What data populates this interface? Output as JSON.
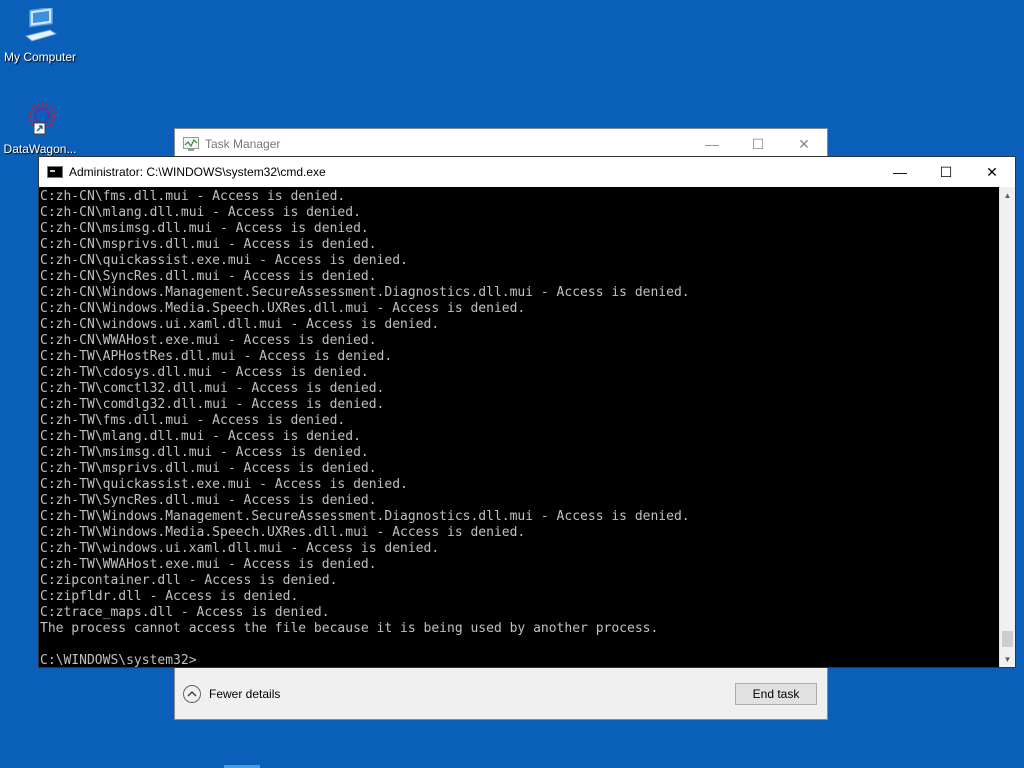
{
  "desktop": {
    "icons": [
      {
        "label": "My Computer",
        "icon": "computer-icon"
      },
      {
        "label": "DataWagon...",
        "icon": "datawagon-icon"
      }
    ]
  },
  "taskmgr": {
    "title": "Task Manager",
    "fewer_details": "Fewer details",
    "end_task": "End task"
  },
  "cmd": {
    "title": "Administrator: C:\\WINDOWS\\system32\\cmd.exe",
    "lines": [
      "C:zh-CN\\fms.dll.mui - Access is denied.",
      "C:zh-CN\\mlang.dll.mui - Access is denied.",
      "C:zh-CN\\msimsg.dll.mui - Access is denied.",
      "C:zh-CN\\msprivs.dll.mui - Access is denied.",
      "C:zh-CN\\quickassist.exe.mui - Access is denied.",
      "C:zh-CN\\SyncRes.dll.mui - Access is denied.",
      "C:zh-CN\\Windows.Management.SecureAssessment.Diagnostics.dll.mui - Access is denied.",
      "C:zh-CN\\Windows.Media.Speech.UXRes.dll.mui - Access is denied.",
      "C:zh-CN\\windows.ui.xaml.dll.mui - Access is denied.",
      "C:zh-CN\\WWAHost.exe.mui - Access is denied.",
      "C:zh-TW\\APHostRes.dll.mui - Access is denied.",
      "C:zh-TW\\cdosys.dll.mui - Access is denied.",
      "C:zh-TW\\comctl32.dll.mui - Access is denied.",
      "C:zh-TW\\comdlg32.dll.mui - Access is denied.",
      "C:zh-TW\\fms.dll.mui - Access is denied.",
      "C:zh-TW\\mlang.dll.mui - Access is denied.",
      "C:zh-TW\\msimsg.dll.mui - Access is denied.",
      "C:zh-TW\\msprivs.dll.mui - Access is denied.",
      "C:zh-TW\\quickassist.exe.mui - Access is denied.",
      "C:zh-TW\\SyncRes.dll.mui - Access is denied.",
      "C:zh-TW\\Windows.Management.SecureAssessment.Diagnostics.dll.mui - Access is denied.",
      "C:zh-TW\\Windows.Media.Speech.UXRes.dll.mui - Access is denied.",
      "C:zh-TW\\windows.ui.xaml.dll.mui - Access is denied.",
      "C:zh-TW\\WWAHost.exe.mui - Access is denied.",
      "C:zipcontainer.dll - Access is denied.",
      "C:zipfldr.dll - Access is denied.",
      "C:ztrace_maps.dll - Access is denied.",
      "The process cannot access the file because it is being used by another process.",
      "",
      "C:\\WINDOWS\\system32>"
    ]
  }
}
